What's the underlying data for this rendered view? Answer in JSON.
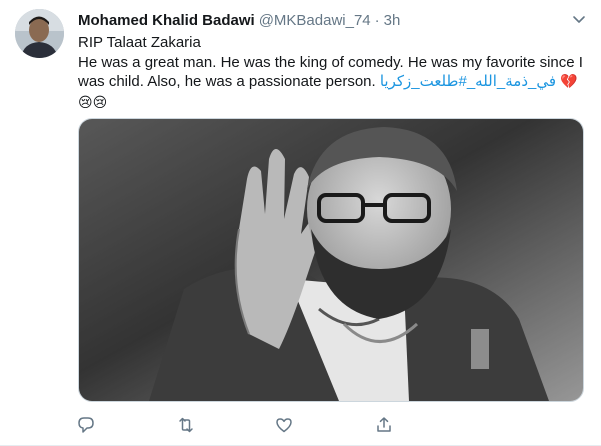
{
  "author": {
    "name": "Mohamed Khalid Badawi",
    "handle": "@MKBadawi_74",
    "separator": "·",
    "time": "3h"
  },
  "tweet": {
    "line1": "RIP Talaat Zakaria",
    "line2": "He was a great man. He was the  king of comedy. He was my favorite since I was child. Also, he was a passionate person.",
    "hashtag1": "#طلعت_زكريا",
    "hashtag2": "في_ذمة_الله_",
    "emoji_heart": "💔",
    "emoji_faces": "😢😢"
  },
  "icons": {
    "menu": "chevron-down-icon",
    "reply": "reply-icon",
    "retweet": "retweet-icon",
    "like": "heart-icon",
    "share": "share-icon"
  },
  "colors": {
    "text": "#14171a",
    "secondary": "#657786",
    "link": "#1b95e0",
    "icon": "#657786",
    "border": "#e6ecf0"
  }
}
